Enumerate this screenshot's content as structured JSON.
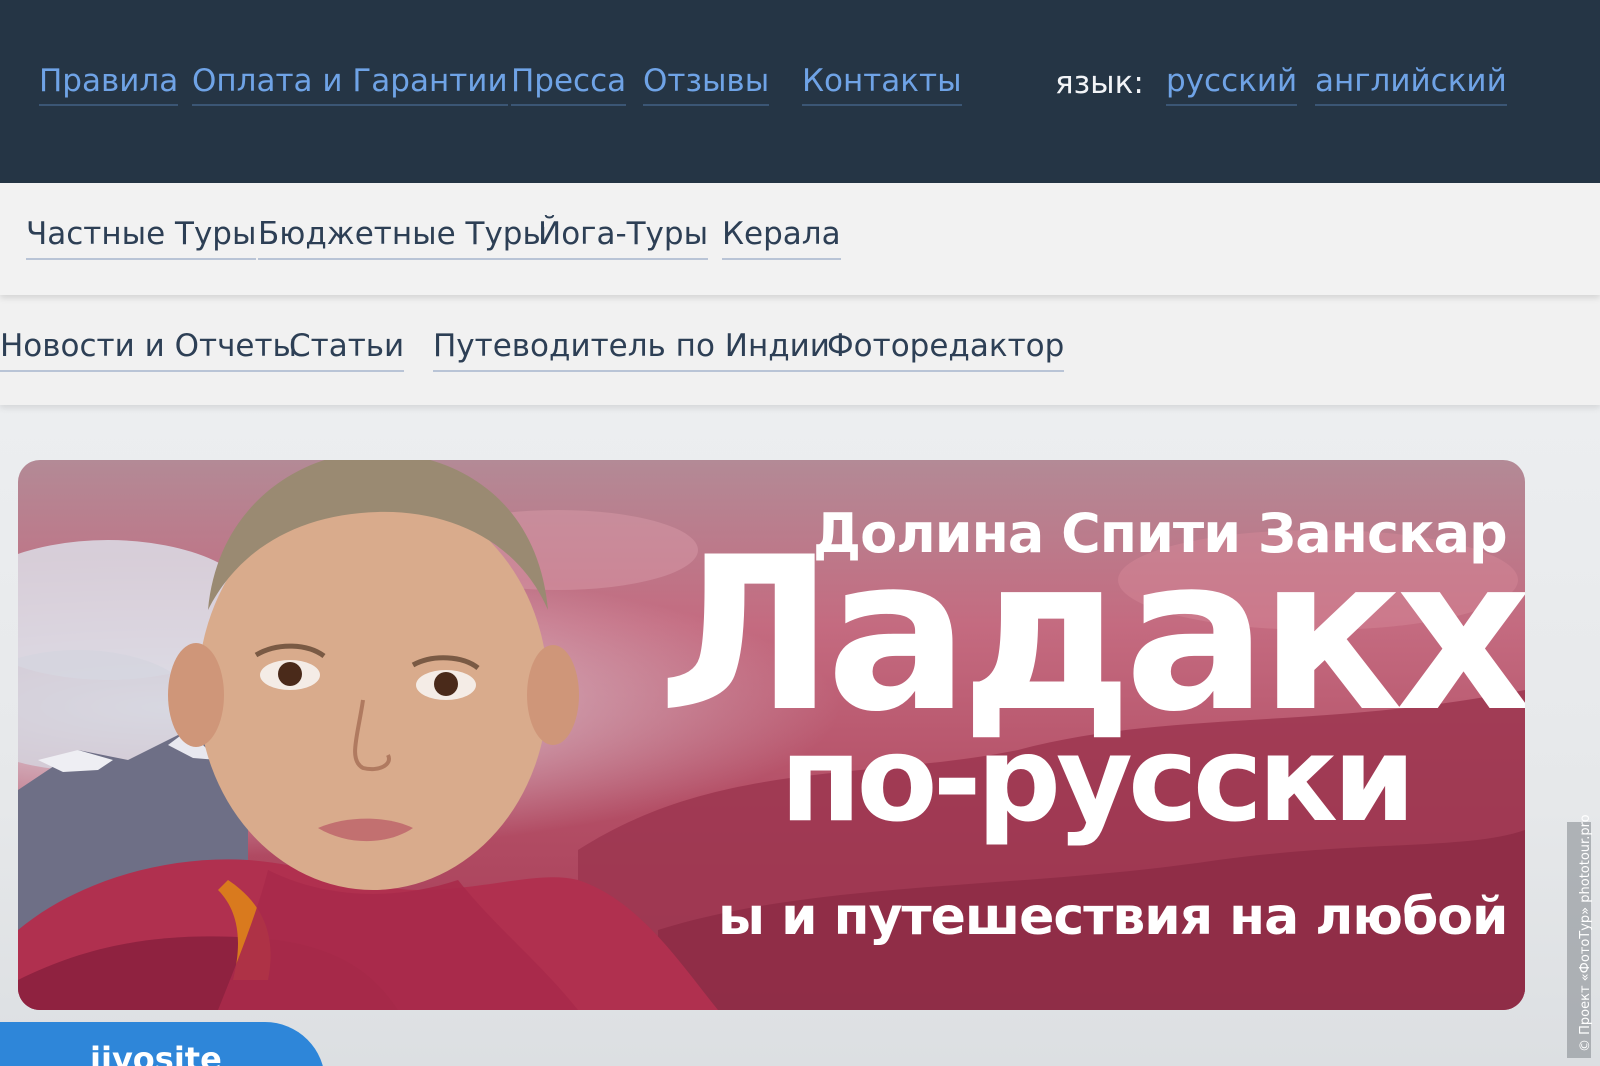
{
  "top_nav": {
    "links": [
      "Правила",
      "Оплата и Гарантии",
      "Пресса",
      "Отзывы",
      "Контакты"
    ],
    "language_label": "язык:",
    "languages": [
      "русский",
      "английский"
    ]
  },
  "menu_tours": {
    "items": [
      "Частные Туры",
      "Бюджетные Туры",
      "Йога-Туры",
      "Керала"
    ]
  },
  "menu_info": {
    "items": [
      "Новости и Отчеты",
      "Статьи",
      "Путеводитель по Индии",
      "Фоторедактор"
    ]
  },
  "banner": {
    "subtitle": "Долина Спити  Занскар",
    "title": "Ладакх",
    "title2": "по-русски",
    "tagline": "ы и путешествия на любой вкус"
  },
  "widget": {
    "text": "jivosite"
  },
  "copyright": "© Проект «ФотоТур» phototour.pro",
  "colors": {
    "topbar_bg": "#253545",
    "link_blue": "#6fa3e6",
    "menu_text": "#2d3f55",
    "banner_red": "#b44f66",
    "widget_blue": "#2e86d9"
  }
}
